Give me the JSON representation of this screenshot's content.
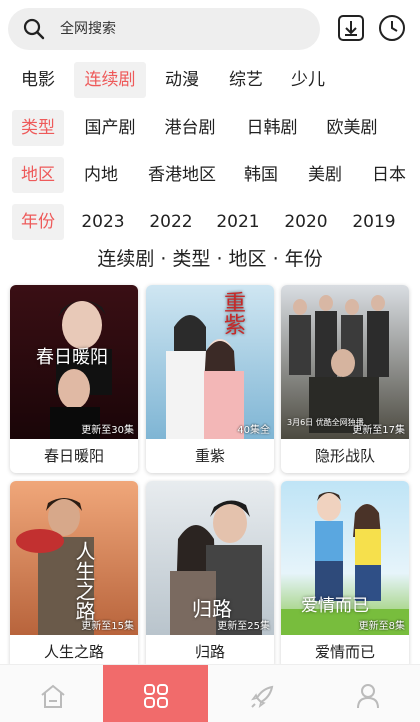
{
  "search": {
    "placeholder": "全网搜索"
  },
  "icons": {
    "search": "search-icon",
    "download": "download-icon",
    "history": "history-clock-icon",
    "home": "home-icon",
    "category": "category-grid-icon",
    "rocket": "rocket-icon",
    "profile": "profile-icon"
  },
  "colors": {
    "accent": "#ee5a5a",
    "active_tab": "#f16b6b",
    "chip_bg": "#f1f1f1"
  },
  "channels": [
    "电影",
    "连续剧",
    "动漫",
    "综艺",
    "少儿"
  ],
  "filters": {
    "type": {
      "label": "类型",
      "options": [
        "国产剧",
        "港台剧",
        "日韩剧",
        "欧美剧"
      ]
    },
    "region": {
      "label": "地区",
      "options": [
        "内地",
        "香港地区",
        "韩国",
        "美剧",
        "日本"
      ]
    },
    "year": {
      "label": "年份",
      "options": [
        "2023",
        "2022",
        "2021",
        "2020",
        "2019"
      ]
    }
  },
  "summary": "连续剧 · 类型 · 地区 · 年份",
  "cards": [
    {
      "title": "春日暖阳",
      "badge": "更新至30集",
      "poster_text": "春日暖阳"
    },
    {
      "title": "重紫",
      "badge": "40集全",
      "poster_text": "重紫"
    },
    {
      "title": "隐形战队",
      "badge": "更新至17集",
      "poster_text": "3月6日 优酷全网独播"
    },
    {
      "title": "人生之路",
      "badge": "更新至15集",
      "poster_text": "人生之路"
    },
    {
      "title": "归路",
      "badge": "更新至25集",
      "poster_text": "归路"
    },
    {
      "title": "爱情而已",
      "badge": "更新至8集",
      "poster_text": "爱情而已"
    }
  ]
}
